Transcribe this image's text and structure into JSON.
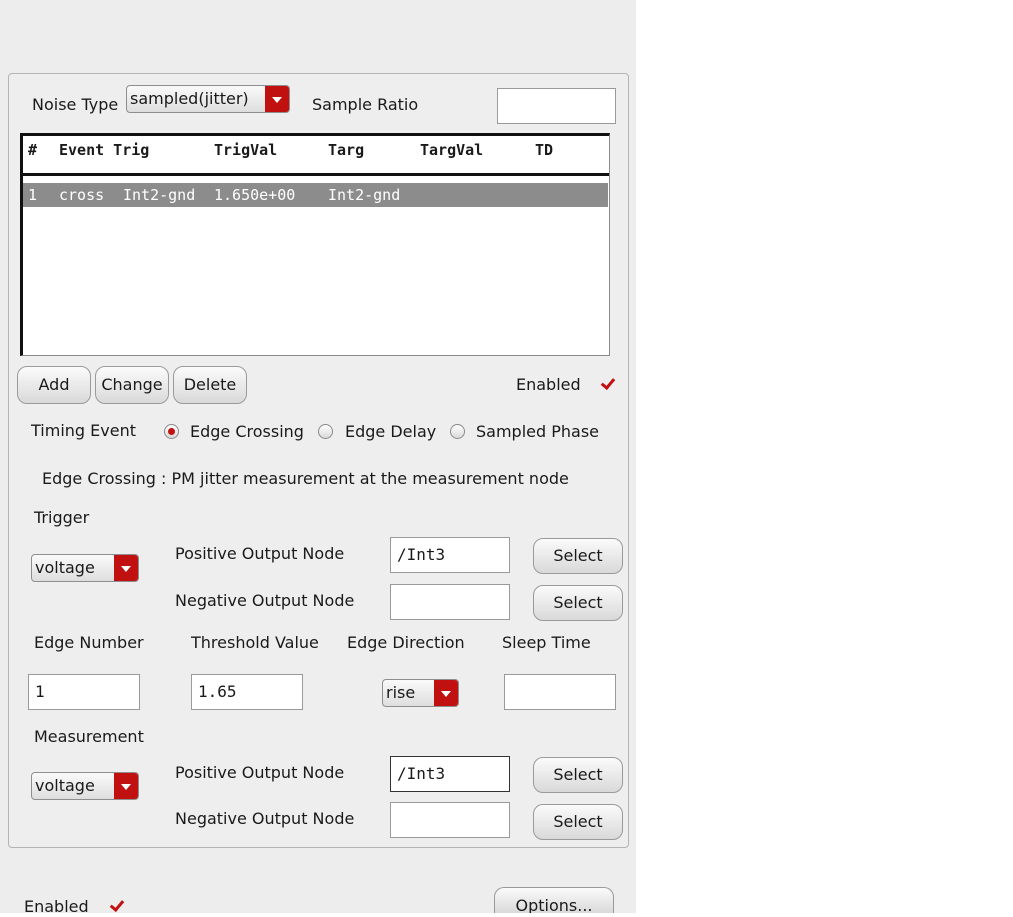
{
  "noise_type": {
    "label": "Noise Type",
    "value": "sampled(jitter)"
  },
  "sample_ratio": {
    "label": "Sample Ratio",
    "value": ""
  },
  "table": {
    "headers": [
      "#",
      "Event Trig",
      "TrigVal",
      "Targ",
      "TargVal",
      "TD"
    ],
    "rows": [
      {
        "num": "1",
        "event": "cross",
        "trig": "Int2-gnd",
        "trigval": "1.650e+00",
        "targ": "Int2-gnd"
      }
    ]
  },
  "buttons": {
    "add": "Add",
    "change": "Change",
    "delete": "Delete",
    "select": "Select",
    "options": "Options..."
  },
  "enabled_label": "Enabled",
  "timing_event": {
    "label": "Timing Event",
    "options": [
      "Edge Crossing",
      "Edge Delay",
      "Sampled Phase"
    ],
    "selected": "Edge Crossing"
  },
  "description": "Edge Crossing : PM jitter measurement at the measurement node",
  "trigger": {
    "label": "Trigger",
    "type": "voltage",
    "pos_label": "Positive Output Node",
    "pos_value": "/Int3",
    "neg_label": "Negative Output Node",
    "neg_value": ""
  },
  "params": {
    "edge_number_label": "Edge Number",
    "edge_number": "1",
    "threshold_label": "Threshold Value",
    "threshold": "1.65",
    "edge_direction_label": "Edge Direction",
    "edge_direction": "rise",
    "sleep_time_label": "Sleep Time",
    "sleep_time": ""
  },
  "measurement": {
    "label": "Measurement",
    "type": "voltage",
    "pos_label": "Positive Output Node",
    "pos_value": "/Int3",
    "neg_label": "Negative Output Node",
    "neg_value": ""
  },
  "colors": {
    "accent": "#c01010",
    "selection": "#8c8c8c",
    "panel": "#ededed"
  }
}
